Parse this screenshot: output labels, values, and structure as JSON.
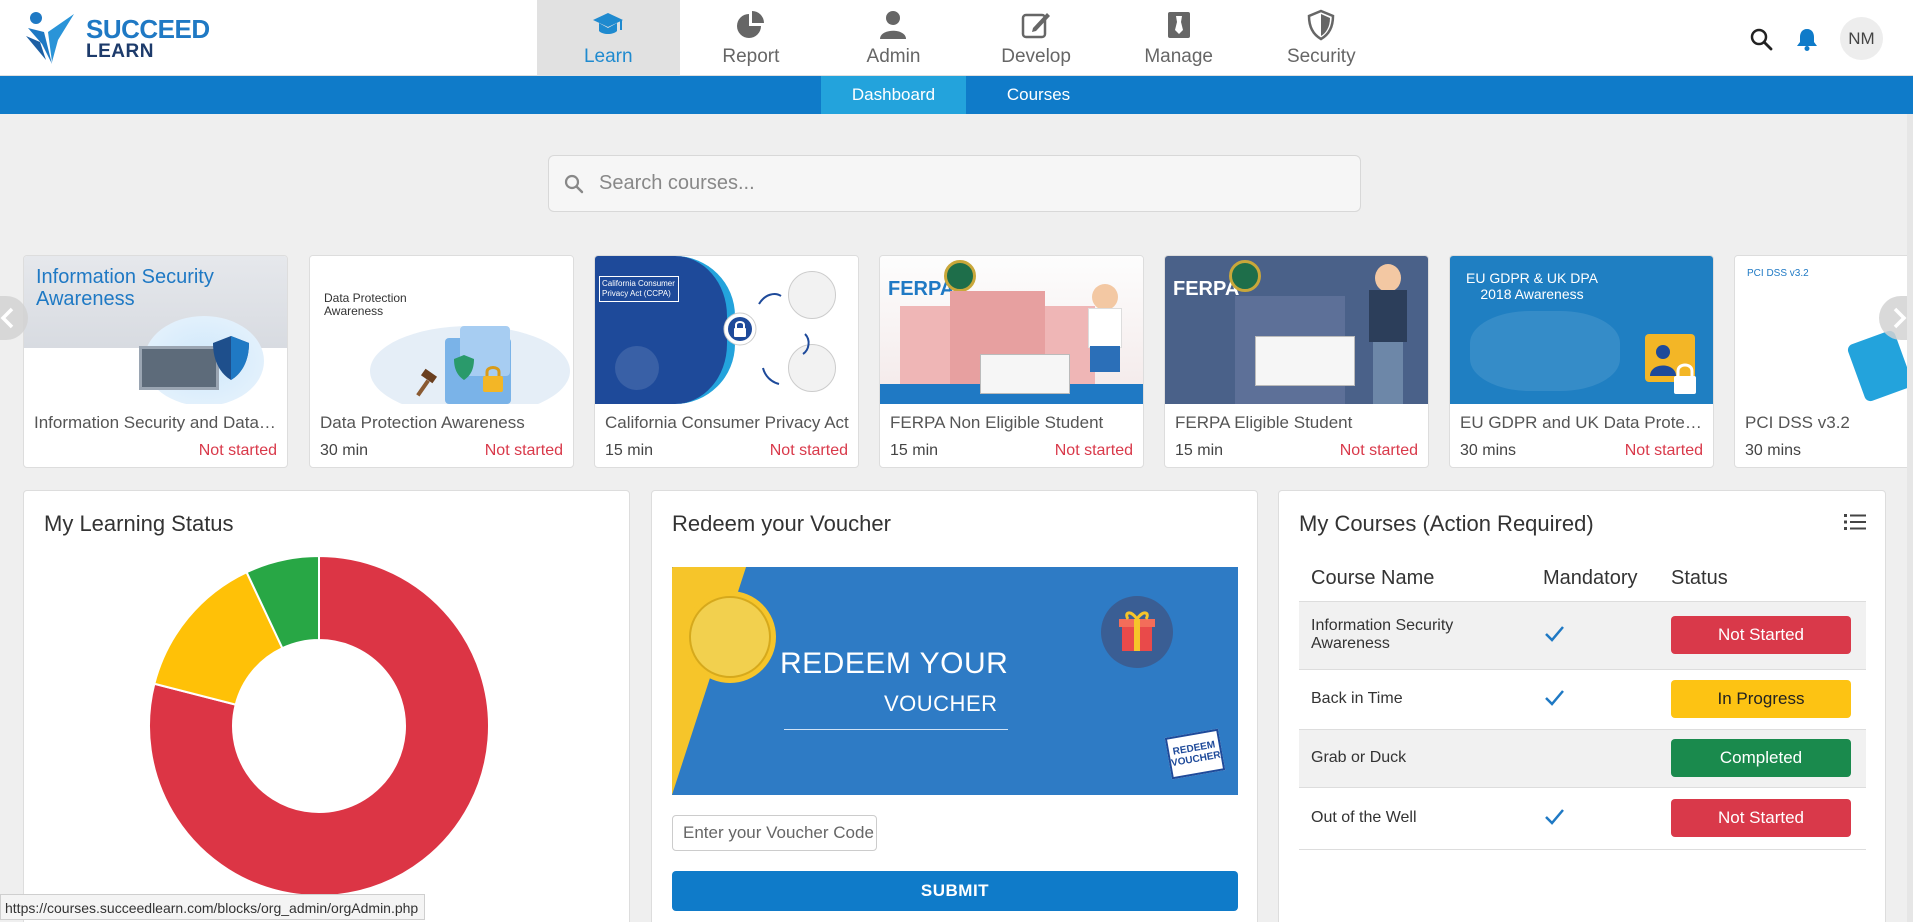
{
  "header": {
    "logo_line1": "SUCCEED",
    "logo_line2": "LEARN",
    "modules": [
      {
        "label": "Learn",
        "icon": "graduation-cap-icon",
        "active": true
      },
      {
        "label": "Report",
        "icon": "pie-chart-icon",
        "active": false
      },
      {
        "label": "Admin",
        "icon": "user-icon",
        "active": false
      },
      {
        "label": "Develop",
        "icon": "edit-icon",
        "active": false
      },
      {
        "label": "Manage",
        "icon": "manage-icon",
        "active": false
      },
      {
        "label": "Security",
        "icon": "shield-icon",
        "active": false
      }
    ],
    "avatar_initials": "NM"
  },
  "subnav": {
    "tabs": [
      {
        "label": "Dashboard",
        "active": true
      },
      {
        "label": "Courses",
        "active": false
      }
    ]
  },
  "search": {
    "placeholder": "Search courses..."
  },
  "carousel": {
    "cards": [
      {
        "title": "Information Security and Data Protection",
        "duration": "",
        "status": "Not started",
        "thumb_text": "Information Security Awareness"
      },
      {
        "title": "Data Protection Awareness",
        "duration": "30 min",
        "status": "Not started",
        "thumb_text": "Data Protection Awareness"
      },
      {
        "title": "California Consumer Privacy Act",
        "duration": "15 min",
        "status": "Not started",
        "thumb_text": "California Consumer Privacy Act (CCPA)"
      },
      {
        "title": "FERPA Non Eligible Student",
        "duration": "15 min",
        "status": "Not started",
        "thumb_text": "FERPA"
      },
      {
        "title": "FERPA Eligible Student",
        "duration": "15 min",
        "status": "Not started",
        "thumb_text": "FERPA"
      },
      {
        "title": "EU GDPR and UK Data Protection",
        "duration": "30 mins",
        "status": "Not started",
        "thumb_text": "EU GDPR & UK DPA 2018 Awareness"
      },
      {
        "title": "PCI DSS v3.2",
        "duration": "30 mins",
        "status": "",
        "thumb_text": "PCI DSS v3.2"
      }
    ]
  },
  "learning_status": {
    "title": "My Learning Status",
    "chart_data": {
      "type": "pie",
      "values": [
        0.79,
        0.14,
        0.07
      ],
      "colors": [
        "#dc3545",
        "#ffc107",
        "#28a745"
      ]
    }
  },
  "voucher": {
    "title": "Redeem your Voucher",
    "banner_line1": "REDEEM YOUR",
    "banner_line2": "VOUCHER",
    "badge_line1": "REDEEM",
    "badge_line2": "VOUCHER",
    "input_placeholder": "Enter your Voucher Code",
    "submit_label": "SUBMIT"
  },
  "my_courses": {
    "title": "My Courses (Action Required)",
    "columns": [
      "Course Name",
      "Mandatory",
      "Status"
    ],
    "rows": [
      {
        "name": "Information Security Awareness",
        "mandatory": true,
        "status": "Not Started",
        "kind": "not"
      },
      {
        "name": "Back in Time",
        "mandatory": true,
        "status": "In Progress",
        "kind": "prog"
      },
      {
        "name": "Grab or Duck",
        "mandatory": false,
        "status": "Completed",
        "kind": "done"
      },
      {
        "name": "Out of the Well",
        "mandatory": true,
        "status": "Not Started",
        "kind": "not"
      }
    ]
  },
  "status_url": "https://courses.succeedlearn.com/blocks/org_admin/orgAdmin.php"
}
